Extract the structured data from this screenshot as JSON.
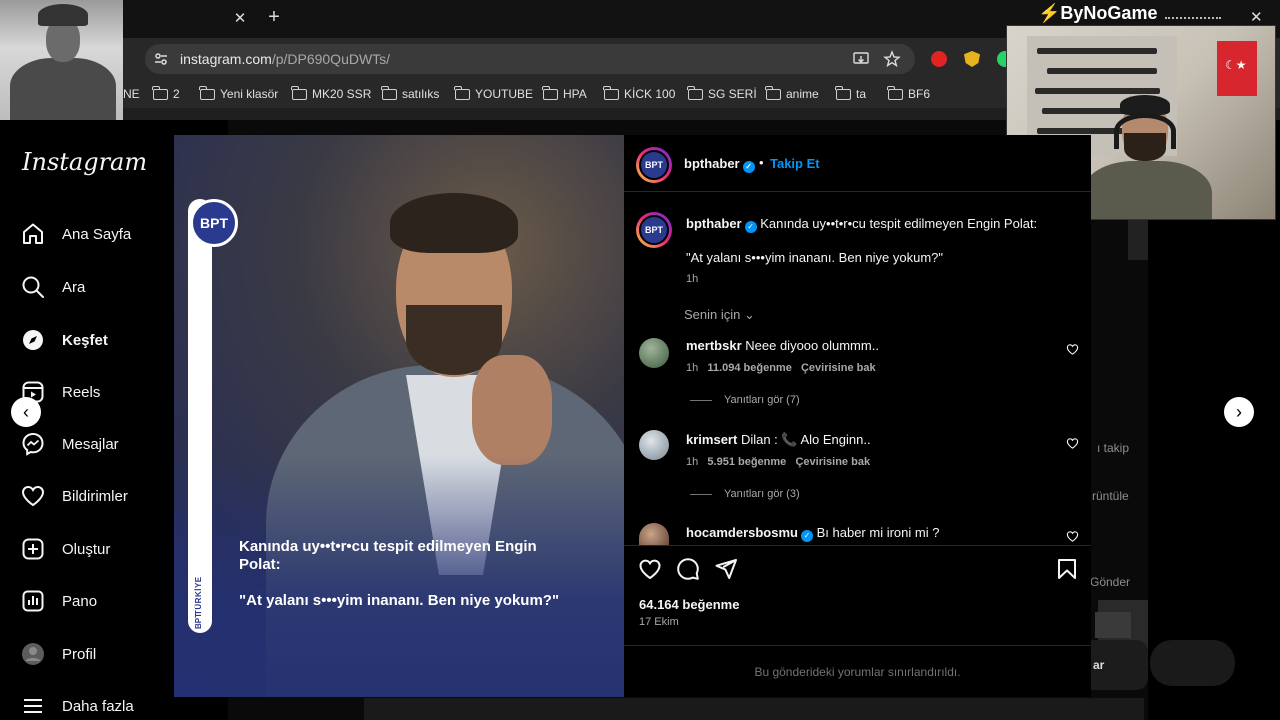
{
  "browser": {
    "url_domain": "instagram.com",
    "url_path": "/p/DP690QuDWTs/",
    "bookmarks": [
      "NE",
      "2",
      "Yeni klasör",
      "MK20 SSR",
      "satılıks",
      "YOUTUBE",
      "HPA",
      "KİCK 100",
      "SG SERİ",
      "anime",
      "ta",
      "BF6"
    ]
  },
  "overlay": {
    "brand_name": "ByNoGame"
  },
  "sidebar": {
    "logo": "Instagram",
    "items": [
      {
        "label": "Ana Sayfa",
        "icon": "home-icon"
      },
      {
        "label": "Ara",
        "icon": "search-icon"
      },
      {
        "label": "Keşfet",
        "icon": "explore-icon"
      },
      {
        "label": "Reels",
        "icon": "reels-icon"
      },
      {
        "label": "Mesajlar",
        "icon": "messenger-icon"
      },
      {
        "label": "Bildirimler",
        "icon": "heart-icon"
      },
      {
        "label": "Oluştur",
        "icon": "create-icon"
      },
      {
        "label": "Pano",
        "icon": "dashboard-icon"
      },
      {
        "label": "Profil",
        "icon": "profile-avatar"
      },
      {
        "label": "Daha fazla",
        "icon": "menu-icon"
      }
    ]
  },
  "background": {
    "text_takip": "ı takip",
    "text_goruntule": "rüntüle",
    "text_gonder": "Gönder",
    "text_ar": "ar"
  },
  "post": {
    "image": {
      "badge": "BPT",
      "vertical_country": "TÜRKİYE",
      "vertical_brand": "BPT",
      "headline": "Kanında uy••t•r•cu tespit edilmeyen Engin Polat:",
      "quote": "\"At yalanı s•••yim inananı. Ben niye yokum?\""
    },
    "header": {
      "username": "bpthaber",
      "separator": "•",
      "follow_label": "Takip Et"
    },
    "caption": {
      "username": "bpthaber",
      "text": "Kanında uy••t•r•cu tespit edilmeyen Engin Polat:",
      "quote": "\"At yalanı s•••yim inananı. Ben niye yokum?\"",
      "time": "1h"
    },
    "sort_label": "Senin için",
    "comments": [
      {
        "username": "mertbskr",
        "text": "Neee diyooo olummm..",
        "time": "1h",
        "likes": "11.094 beğenme",
        "translate": "Çevirisine bak",
        "replies": "Yanıtları gör (7)"
      },
      {
        "username": "krimsert",
        "text": "Dilan : 📞 Alo Enginn..",
        "time": "1h",
        "likes": "5.951 beğenme",
        "translate": "Çevirisine bak",
        "replies": "Yanıtları gör (3)"
      },
      {
        "username": "hocamdersbosmu",
        "text": "Bı haber mi ironi mi ?"
      }
    ],
    "like_count": "64.164 beğenme",
    "date": "17 Ekim",
    "restricted_note": "Bu gönderideki yorumlar sınırlandırıldı."
  },
  "colors": {
    "accent": "#0095f6",
    "brand_red": "#e1242b",
    "image_blue": "#243071"
  }
}
